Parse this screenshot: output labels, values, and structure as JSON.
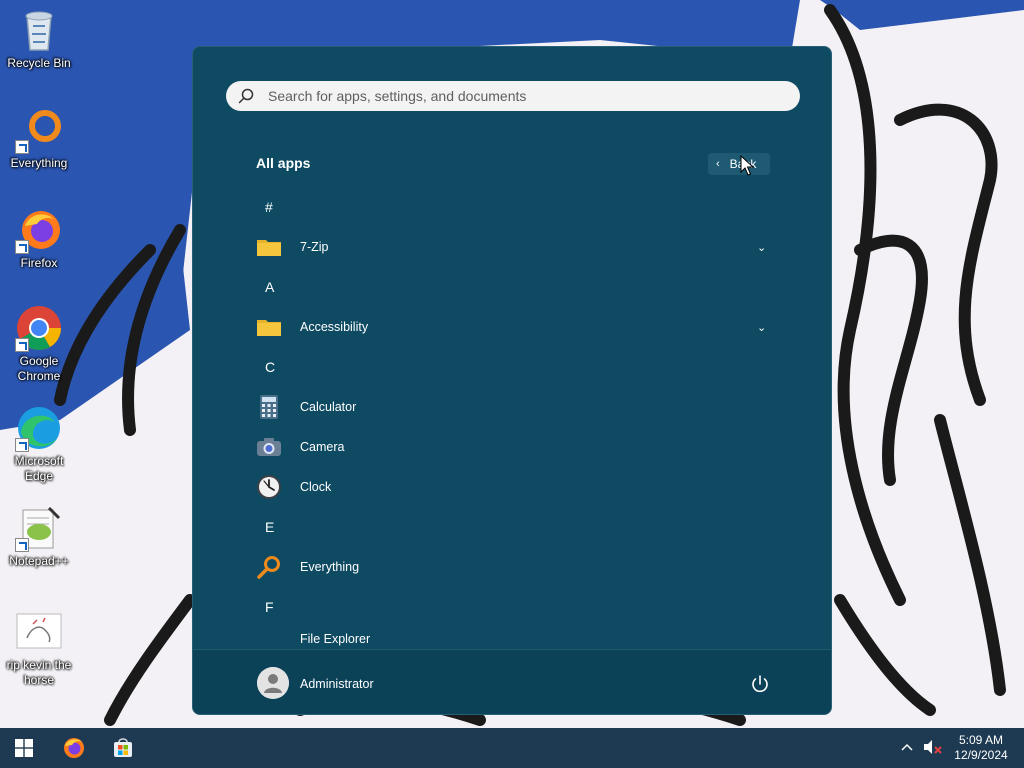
{
  "desktop": {
    "icons": [
      {
        "label": "Recycle Bin",
        "icon": "recycle-bin-icon"
      },
      {
        "label": "Everything",
        "icon": "everything-icon"
      },
      {
        "label": "Firefox",
        "icon": "firefox-icon"
      },
      {
        "label": "Google Chrome",
        "icon": "chrome-icon"
      },
      {
        "label": "Microsoft Edge",
        "icon": "edge-icon"
      },
      {
        "label": "Notepad++",
        "icon": "notepad-plus-plus-icon"
      },
      {
        "label": "rip kevin the horse",
        "icon": "image-file-icon"
      }
    ]
  },
  "start_menu": {
    "search": {
      "placeholder": "Search for apps, settings, and documents"
    },
    "title": "All apps",
    "back_label": "Back",
    "sections": [
      {
        "letter": "#",
        "apps": [
          {
            "label": "7-Zip",
            "icon": "folder-icon",
            "expandable": true
          }
        ]
      },
      {
        "letter": "A",
        "apps": [
          {
            "label": "Accessibility",
            "icon": "folder-icon",
            "expandable": true
          }
        ]
      },
      {
        "letter": "C",
        "apps": [
          {
            "label": "Calculator",
            "icon": "calculator-icon"
          },
          {
            "label": "Camera",
            "icon": "camera-icon"
          },
          {
            "label": "Clock",
            "icon": "clock-icon"
          }
        ]
      },
      {
        "letter": "E",
        "apps": [
          {
            "label": "Everything",
            "icon": "everything-icon"
          }
        ]
      },
      {
        "letter": "F",
        "apps": [
          {
            "label": "File Explorer",
            "icon": "folder-icon"
          }
        ]
      }
    ],
    "user": {
      "name": "Administrator"
    }
  },
  "taskbar": {
    "pinned": [
      "start-icon",
      "firefox-icon",
      "microsoft-store-icon"
    ],
    "time": "5:09 AM",
    "date": "12/9/2024"
  },
  "colors": {
    "start_menu_bg": "#0e4a62",
    "taskbar_bg": "#1e3a52",
    "folder_yellow": "#f5c63c"
  }
}
